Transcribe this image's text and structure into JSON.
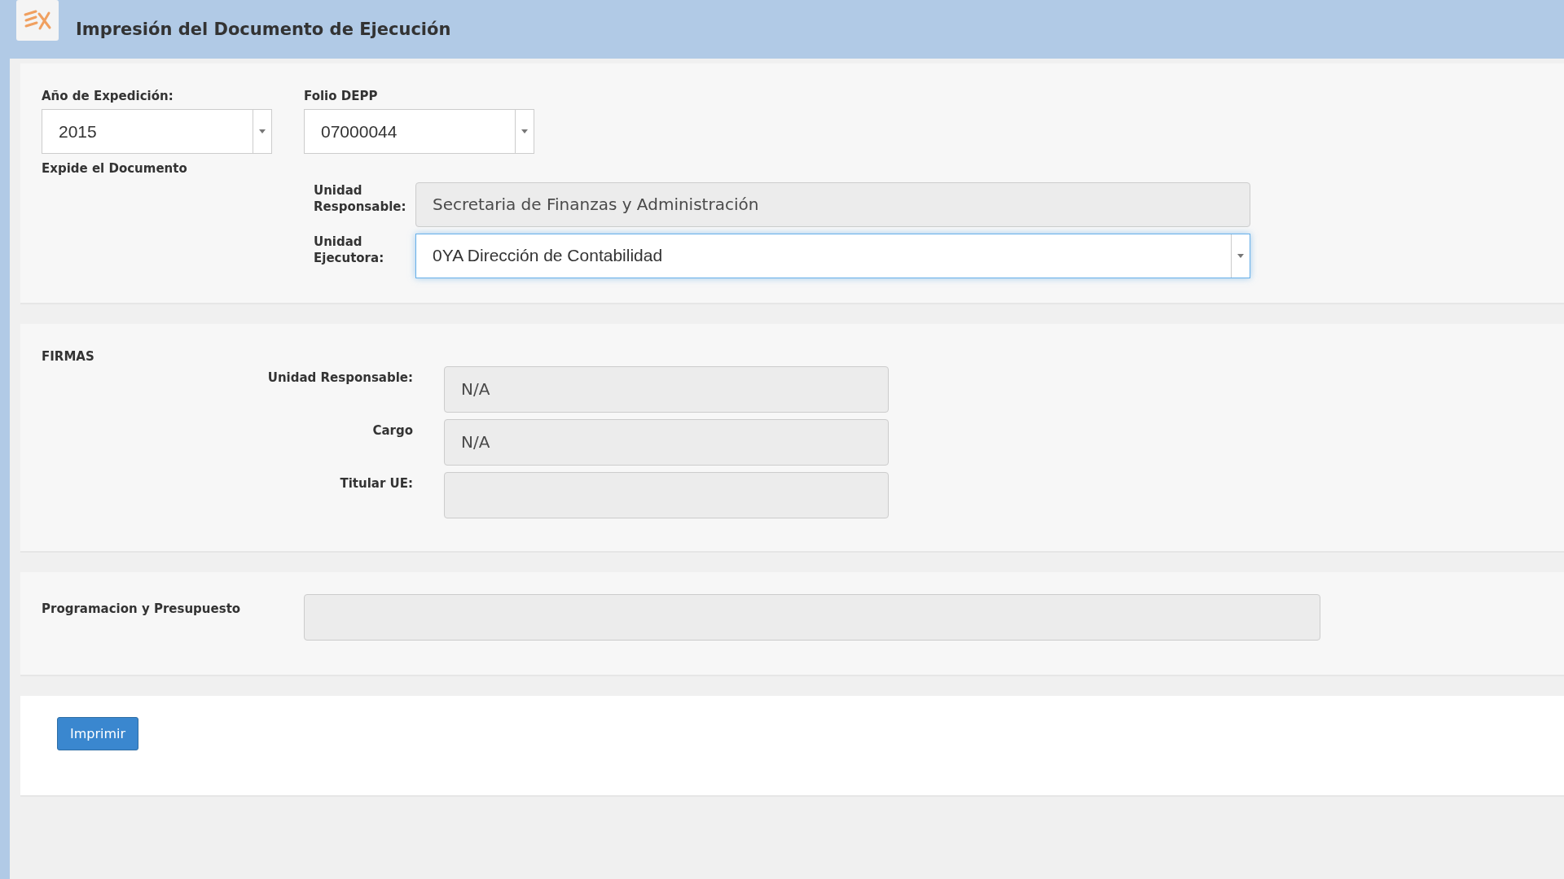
{
  "header": {
    "title": "Impresión del Documento de Ejecución"
  },
  "expedition": {
    "year": {
      "label": "Año de Expedición:",
      "kind": "select",
      "value": "2015",
      "disabled": false,
      "focused": false
    },
    "folio": {
      "label": "Folio DEPP",
      "kind": "select",
      "value": "07000044",
      "disabled": false,
      "focused": false
    },
    "section_label": "Expide el Documento",
    "fields": [
      {
        "label": "Unidad Responsable:",
        "kind": "text",
        "value": "Secretaria de Finanzas y Administración",
        "disabled": true,
        "focused": false
      },
      {
        "label": "Unidad Ejecutora:",
        "kind": "select",
        "value": "0YA Dirección de Contabilidad",
        "disabled": false,
        "focused": true
      }
    ]
  },
  "signatures": {
    "title": "FIRMAS",
    "fields": [
      {
        "label": "Unidad Responsable:",
        "kind": "text",
        "value": "N/A",
        "disabled": true,
        "focused": false
      },
      {
        "label": "Cargo",
        "kind": "text",
        "value": "N/A",
        "disabled": true,
        "focused": false
      },
      {
        "label": "Titular UE:",
        "kind": "text",
        "disabled": true,
        "focused": false
      }
    ]
  },
  "budget": {
    "label": "Programacion y Presupuesto",
    "field": {
      "kind": "text",
      "disabled": true,
      "focused": false
    }
  },
  "actions": {
    "buttons": [
      "Imprimir"
    ]
  }
}
